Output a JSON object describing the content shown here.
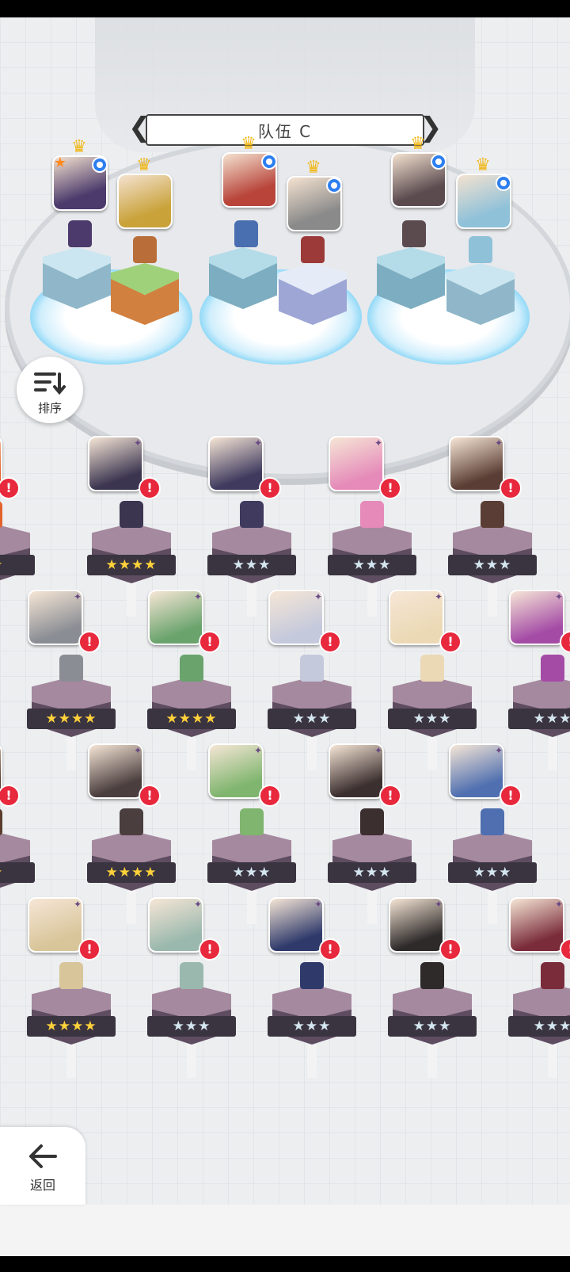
{
  "team": {
    "title": "队伍 C",
    "prev_arrow": "❮",
    "next_arrow": "❯"
  },
  "sort_button": {
    "label": "排序",
    "icon": "sort-icon"
  },
  "back_button": {
    "label": "返回",
    "icon": "back-arrow-icon"
  },
  "lineup": [
    {
      "slot": 1,
      "crown": true,
      "leader_star": true,
      "badge": true,
      "color": "#4b3a6b"
    },
    {
      "slot": 2,
      "crown": true,
      "leader_star": false,
      "badge": false,
      "color": "#c9a23a"
    },
    {
      "slot": 3,
      "crown": true,
      "leader_star": false,
      "badge": true,
      "color": "#b8443a"
    },
    {
      "slot": 4,
      "crown": true,
      "leader_star": false,
      "badge": true,
      "color": "#8a8a8a"
    },
    {
      "slot": 5,
      "crown": true,
      "leader_star": false,
      "badge": true,
      "color": "#5b4b4f"
    },
    {
      "slot": 6,
      "crown": true,
      "leader_star": false,
      "badge": true,
      "color": "#8fc1d9"
    }
  ],
  "roster": [
    {
      "row": 1,
      "cells": [
        {
          "stars": "★★",
          "tier": "gold",
          "color": "#e2622c"
        },
        {
          "stars": "★★★★",
          "tier": "gold",
          "color": "#3b3550"
        },
        {
          "stars": "★★★",
          "tier": "silver",
          "color": "#3f3a5e"
        },
        {
          "stars": "★★★",
          "tier": "silver",
          "color": "#e58ab9"
        },
        {
          "stars": "★★★",
          "tier": "silver",
          "color": "#5a3d34"
        }
      ]
    },
    {
      "row": 2,
      "cells": [
        {
          "stars": "★★★★",
          "tier": "gold",
          "color": "#8a8d94"
        },
        {
          "stars": "★★★★",
          "tier": "gold",
          "color": "#6aa36c"
        },
        {
          "stars": "★★★",
          "tier": "silver",
          "color": "#c4c9dc"
        },
        {
          "stars": "★★★",
          "tier": "silver",
          "color": "#ebd9b5"
        },
        {
          "stars": "★★★",
          "tier": "silver",
          "color": "#a44ba6"
        }
      ]
    },
    {
      "row": 3,
      "cells": [
        {
          "stars": "★★",
          "tier": "gold",
          "color": "#5a3b2c"
        },
        {
          "stars": "★★★★",
          "tier": "gold",
          "color": "#4a3e3e"
        },
        {
          "stars": "★★★",
          "tier": "silver",
          "color": "#7fb56e"
        },
        {
          "stars": "★★★",
          "tier": "silver",
          "color": "#3b2f2f"
        },
        {
          "stars": "★★★",
          "tier": "silver",
          "color": "#4f6fb0"
        }
      ]
    },
    {
      "row": 4,
      "cells": [
        {
          "stars": "★★★★",
          "tier": "gold",
          "color": "#d8c59a"
        },
        {
          "stars": "★★★",
          "tier": "silver",
          "color": "#9ab8ad"
        },
        {
          "stars": "★★★",
          "tier": "silver",
          "color": "#2f3a6b"
        },
        {
          "stars": "★★★",
          "tier": "silver",
          "color": "#2e2a2a"
        },
        {
          "stars": "★★★",
          "tier": "silver",
          "color": "#7a2c3a"
        }
      ]
    }
  ],
  "colors": {
    "alert": "#e8283c",
    "gold_star": "#ffd13a",
    "silver_star": "#d4e6f0",
    "badge_blue": "#2d7ff0"
  }
}
